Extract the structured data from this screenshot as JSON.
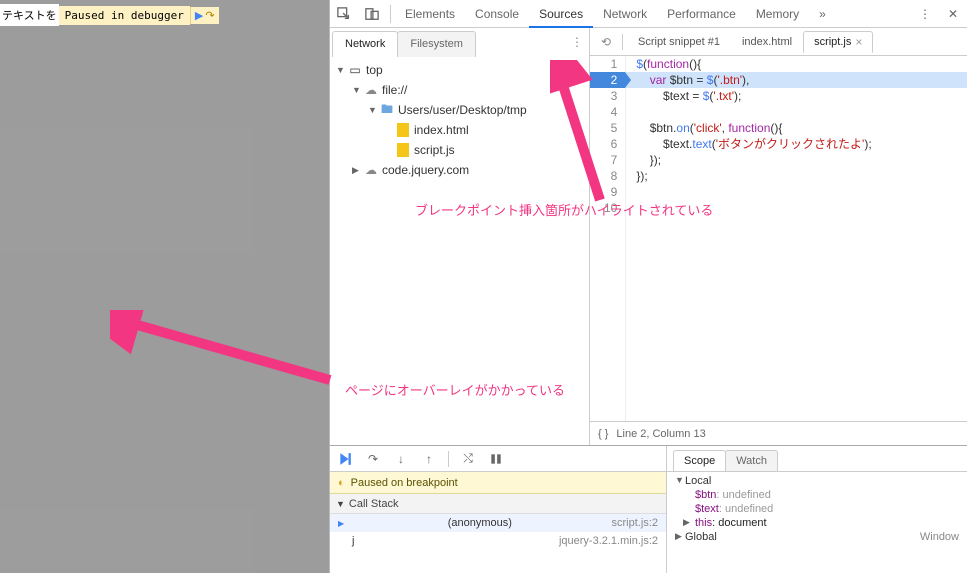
{
  "page": {
    "text_prefix": "テキストを",
    "paused_msg": "Paused in debugger"
  },
  "top_tabs": {
    "elements": "Elements",
    "console": "Console",
    "sources": "Sources",
    "network": "Network",
    "performance": "Performance",
    "memory": "Memory",
    "active": "Sources"
  },
  "nav_tabs": {
    "network": "Network",
    "filesystem": "Filesystem"
  },
  "tree": {
    "top": "top",
    "file": "file://",
    "folder": "Users/user/Desktop/tmp",
    "index": "index.html",
    "script": "script.js",
    "jquery": "code.jquery.com"
  },
  "file_tabs": {
    "snippet": "Script snippet #1",
    "index": "index.html",
    "script": "script.js"
  },
  "code": {
    "l1": "$(function(){",
    "l2": "    var $btn = $('.btn'),",
    "l3": "        $text = $('.txt');",
    "l4": "",
    "l5": "    $btn.on('click', function(){",
    "l6": "        $text.text('ボタンがクリックされたよ');",
    "l7": "    });",
    "l8": "});",
    "l9": "",
    "l10": ""
  },
  "status": {
    "cursor": "Line 2, Column 13"
  },
  "debug": {
    "paused": "Paused on breakpoint",
    "callstack_hdr": "Call Stack",
    "frames": [
      {
        "name": "(anonymous)",
        "loc": "script.js:2"
      },
      {
        "name": "j",
        "loc": "jquery-3.2.1.min.js:2"
      }
    ]
  },
  "scope": {
    "tab_scope": "Scope",
    "tab_watch": "Watch",
    "local": "Local",
    "btn_k": "$btn",
    "btn_v": ": undefined",
    "text_k": "$text",
    "text_v": ": undefined",
    "this_k": "this",
    "this_v": ": document",
    "global": "Global",
    "global_v": "Window"
  },
  "annot": {
    "a1": "ブレークポイント挿入箇所がハイライトされている",
    "a2": "ページにオーバーレイがかかっている"
  },
  "ln": {
    "1": "1",
    "2": "2",
    "3": "3",
    "4": "4",
    "5": "5",
    "6": "6",
    "7": "7",
    "8": "8",
    "9": "9",
    "10": "10"
  }
}
